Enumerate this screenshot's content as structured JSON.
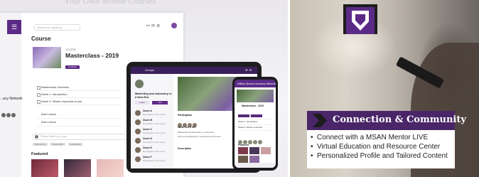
{
  "laptop": {
    "header_fragment": "Your Own Mobile Courses",
    "sidebar_label": "...acy Network",
    "search_placeholder": "Search for anything",
    "course_heading": "Course",
    "course_tag": "COURSE",
    "course_title": "Masterclass - 2019",
    "course_button": "Continue",
    "lessons": [
      "Masterclass Overview",
      "Week 1: Introduction",
      "Week 2: What's expected of you"
    ],
    "extra_items": [
      "Add Lesson",
      "Add Lesson"
    ],
    "comment_placeholder": "Please attach your topic",
    "tags": [
      "Networking",
      "Mentorship",
      "Leadership"
    ],
    "featured_label": "Featured"
  },
  "tablet": {
    "header_title": "Groups",
    "group_name": "Marketing and Advocacy in a New Era",
    "btn_invite": "Invite",
    "btn_join": "Join",
    "zones": [
      {
        "name": "Zoom A",
        "sub": "Description of the event"
      },
      {
        "name": "Zoom B",
        "sub": "Description of the event"
      },
      {
        "name": "Zoom C",
        "sub": "Description of the event"
      },
      {
        "name": "Zoom D",
        "sub": "Description of the event"
      },
      {
        "name": "Zoom E",
        "sub": "Description of the event"
      },
      {
        "name": "Zoom F",
        "sub": "Description of the event"
      }
    ],
    "participants_label": "Participants",
    "what_label": "What You'll Get",
    "lines": [
      "Marketing and Advocacy in a New Era",
      "Find out participants in a relaxed environment"
    ],
    "description_label": "Description"
  },
  "phone": {
    "header": "Military Spouse Advocacy Network",
    "course_title": "Masterclass - 2019",
    "list": [
      "Masterclass Overview",
      "Week 1: Introduction",
      "Week 2: What's expected"
    ],
    "featured_label": "Featured"
  },
  "promo": {
    "title": "Connection & Community",
    "bullets": [
      "Connect with a MSAN Mentor LIVE",
      "Virtual Education and Resource Center",
      "Personalized Profile and Tailored Content"
    ],
    "accent": "#4a2669",
    "brand": "#5b2a86"
  }
}
